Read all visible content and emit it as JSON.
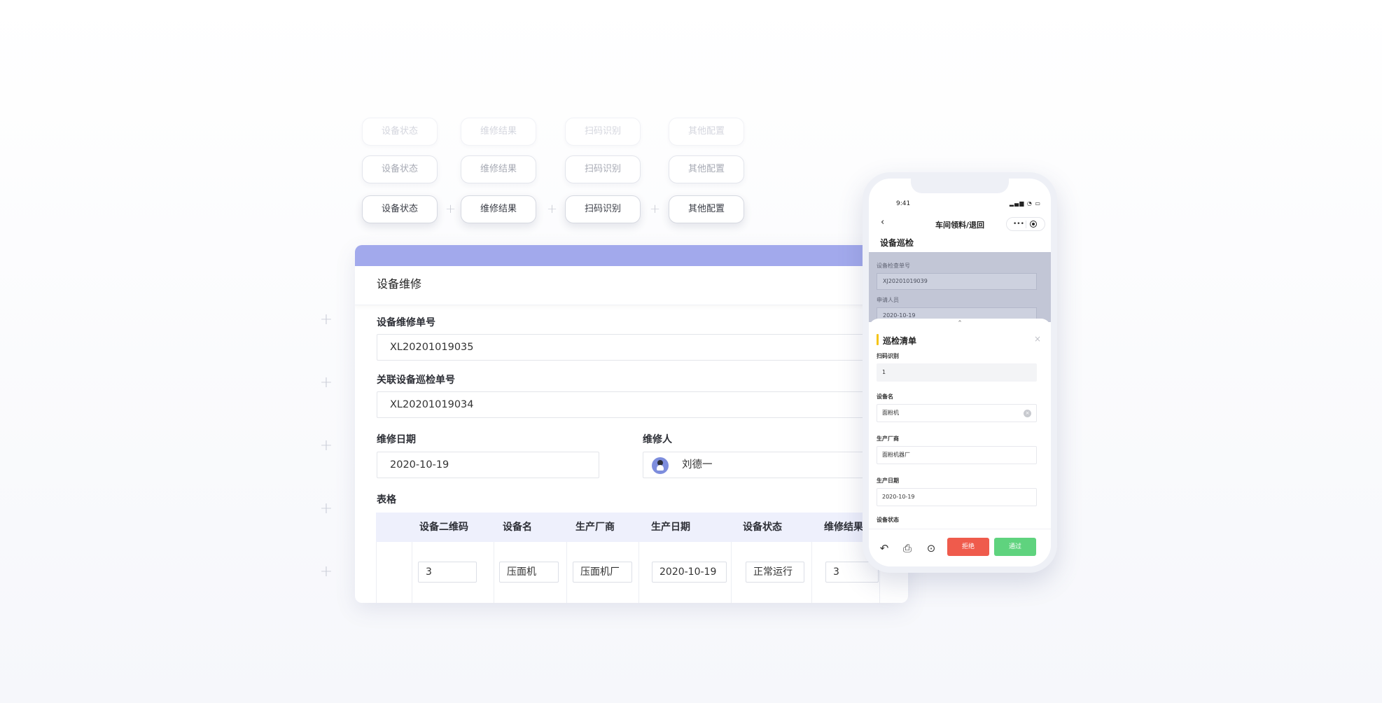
{
  "chips": {
    "status": "设备状态",
    "result": "维修结果",
    "scan": "扫码识别",
    "other": "其他配置"
  },
  "card": {
    "title": "设备维修",
    "order_no_label": "设备维修单号",
    "order_no_value": "XL20201019035",
    "inspect_no_label": "关联设备巡检单号",
    "inspect_no_value": "XL20201019034",
    "date_label": "维修日期",
    "date_value": "2020-10-19",
    "repairer_label": "维修人",
    "repairer_value": "刘德一",
    "table_label": "表格",
    "table": {
      "columns": [
        "设备二维码",
        "设备名",
        "生产厂商",
        "生产日期",
        "设备状态",
        "维修结果"
      ],
      "row": [
        "3",
        "压面机",
        "压面机厂",
        "2020-10-19",
        "正常运行",
        "3"
      ]
    }
  },
  "phone": {
    "time": "9:41",
    "nav_title": "车间领料/退回",
    "page_title": "设备巡检",
    "overlay": {
      "check_no_label": "设备检查单号",
      "check_no_value": "XJ20201019039",
      "applicant_label": "申请人员",
      "applicant_value": "2020-10-19"
    },
    "sheet": {
      "title": "巡检清单",
      "scan_label": "扫码识别",
      "scan_value": "1",
      "device_label": "设备名",
      "device_value": "面粉机",
      "maker_label": "生产厂商",
      "maker_value": "面粉机器厂",
      "date_label": "生产日期",
      "date_value": "2020-10-19",
      "status_label": "设备状态"
    },
    "reject": "拒绝",
    "approve": "通过",
    "colors": {
      "reject": "#ef5b4c",
      "approve": "#5fd37e",
      "accent": "#f5c518"
    }
  },
  "icons": [
    "plus-icon",
    "back-icon",
    "more-icon",
    "close-icon",
    "chevron-up-icon",
    "clear-icon",
    "undo-icon",
    "save-icon",
    "ellipsis-icon"
  ]
}
